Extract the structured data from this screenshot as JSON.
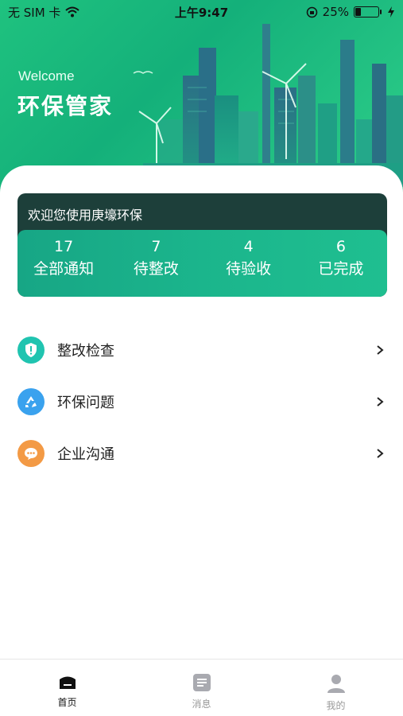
{
  "status_bar": {
    "carrier": "无 SIM 卡",
    "time": "上午9:47",
    "battery": "25%",
    "battery_level": 0.25,
    "icons": [
      "wifi-icon",
      "orientation-lock-icon",
      "battery-icon",
      "charging-icon"
    ]
  },
  "header": {
    "welcome": "Welcome",
    "title": "环保管家"
  },
  "summary_card": {
    "title": "欢迎您使用庚壕环保",
    "stats": [
      {
        "value": "17",
        "label": "全部通知"
      },
      {
        "value": "7",
        "label": "待整改"
      },
      {
        "value": "4",
        "label": "待验收"
      },
      {
        "value": "6",
        "label": "已完成"
      }
    ]
  },
  "menu": {
    "items": [
      {
        "label": "整改检查",
        "icon": "shield-alert-icon",
        "color": "#20c4b0"
      },
      {
        "label": "环保问题",
        "icon": "recycle-icon",
        "color": "#3aa2ee"
      },
      {
        "label": "企业沟通",
        "icon": "chat-bubble-icon",
        "color": "#f39a45"
      }
    ]
  },
  "tabbar": {
    "tabs": [
      {
        "label": "首页",
        "icon": "home-icon",
        "active": true
      },
      {
        "label": "消息",
        "icon": "message-icon",
        "active": false
      },
      {
        "label": "我的",
        "icon": "profile-icon",
        "active": false
      }
    ]
  },
  "colors": {
    "brand_green": "#1fc27f",
    "card_dark": "#1d3f3a",
    "card_accent": "#1bb58c"
  }
}
